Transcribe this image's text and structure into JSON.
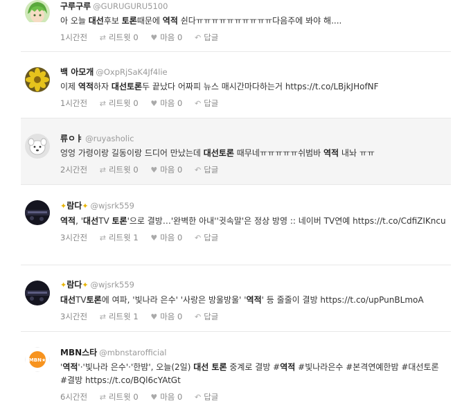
{
  "tweets": [
    {
      "name": "구루구루",
      "handle": "@GURUGURU5100",
      "text_parts": [
        [
          "아 오늘 ",
          0
        ],
        [
          "대선",
          1
        ],
        [
          "후보 ",
          0
        ],
        [
          "토론",
          1
        ],
        [
          "때문에 ",
          0
        ],
        [
          "역적",
          1
        ],
        [
          " 쉰다ㅠㅠㅠㅠㅠㅠㅠㅠㅠㅠ다음주에 봐야 해....",
          0
        ]
      ],
      "time": "1시간전",
      "retweet": "리트윗 0",
      "like": "마음 0",
      "reply": "답글"
    },
    {
      "name": "백 아모개",
      "handle": "@OxpRjSaK4Jf4lie",
      "text_parts": [
        [
          "이제 ",
          0
        ],
        [
          "역적",
          1
        ],
        [
          "하자 ",
          0
        ],
        [
          "대선토론",
          1
        ],
        [
          "두 끝났다 어짜피 뉴스 매시간마다하는거 https://t.co/LBjkJHofNF",
          0
        ]
      ],
      "time": "1시간전",
      "retweet": "리트윗 0",
      "like": "마음 0",
      "reply": "답글"
    },
    {
      "name": "류ㅇㅑ",
      "handle": "@ruyasholic",
      "text_parts": [
        [
          "엉엉 가령이랑 길동이랑 드디어 만났는데 ",
          0
        ],
        [
          "대선토론",
          1
        ],
        [
          " 때무네ㅠㅠㅠㅠㅠ쉬범바 ",
          0
        ],
        [
          "역적",
          1
        ],
        [
          " 내놔 ㅠㅠ",
          0
        ]
      ],
      "time": "2시간전",
      "retweet": "리트윗 0",
      "like": "마음 0",
      "reply": "답글"
    },
    {
      "name": "람다",
      "handle": "@wjsrk559",
      "text_parts": [
        [
          "역적",
          1
        ],
        [
          ", '",
          0
        ],
        [
          "대선",
          1
        ],
        [
          "TV ",
          0
        ],
        [
          "토론",
          1
        ],
        [
          "'으로 결방…'완벽한 아내''귓속말'은 정상 방영 :: 네이버 TV연예 https://t.co/CdfiZIKncu",
          0
        ]
      ],
      "time": "3시간전",
      "retweet": "리트윗 1",
      "like": "마음 0",
      "reply": "답글"
    },
    {
      "name": "람다",
      "handle": "@wjsrk559",
      "text_parts": [
        [
          "대선",
          1
        ],
        [
          "TV",
          0
        ],
        [
          "토론",
          1
        ],
        [
          "에 여파, '빛나라 은수' '사랑은 방울방울' '",
          0
        ],
        [
          "역적",
          1
        ],
        [
          "' 등 줄줄이 결방 https://t.co/upPunBLmoA",
          0
        ]
      ],
      "time": "3시간전",
      "retweet": "리트윗 1",
      "like": "마음 0",
      "reply": "답글"
    },
    {
      "name": "MBN스타",
      "handle": "@mbnstarofficial",
      "text_parts": [
        [
          "'",
          0
        ],
        [
          "역적",
          1
        ],
        [
          "'·'빛나라 은수'·'한밤', 오늘(2일) ",
          0
        ],
        [
          "대선 토론",
          1
        ],
        [
          " 중계로 결방 #",
          0
        ],
        [
          "역적",
          1
        ],
        [
          " #빛나라은수 #본격연예한밤 #대선토론 #결방 https://t.co/BQl6cYAtGt",
          0
        ]
      ],
      "time": "6시간전",
      "retweet": "리트윗 0",
      "like": "마음 0",
      "reply": "답글"
    }
  ],
  "avatar_icons": [
    "green-hair-character-avatar",
    "yellow-flower-avatar",
    "white-dog-avatar",
    "dark-stage-avatar",
    "dark-stage-avatar",
    "mbn-star-logo-avatar"
  ],
  "logo_text": "MBN★"
}
